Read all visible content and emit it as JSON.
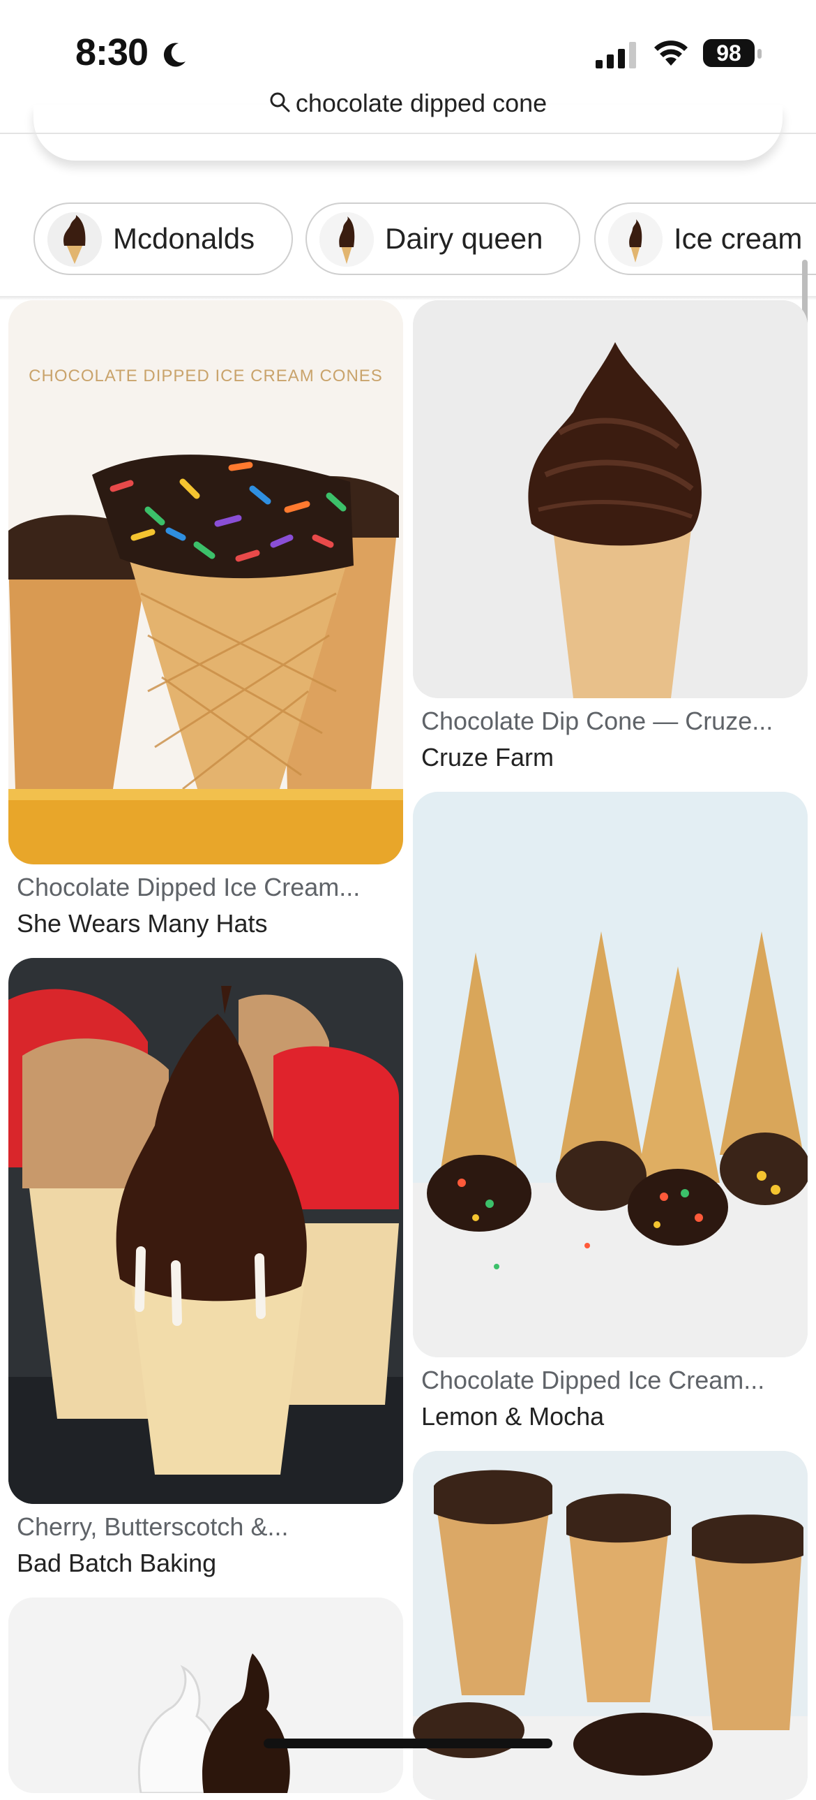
{
  "status_bar": {
    "time": "8:30",
    "battery": "98"
  },
  "search": {
    "query": "chocolate dipped cone"
  },
  "chips": [
    {
      "label": "Mcdonalds",
      "thumb_icon": "ice-cream-cone-icon"
    },
    {
      "label": "Dairy queen",
      "thumb_icon": "ice-cream-cone-icon"
    },
    {
      "label": "Ice cream",
      "thumb_icon": "ice-cream-cone-icon"
    }
  ],
  "pins": [
    {
      "image_text": "CHOCOLATE DIPPED ICE CREAM CONES",
      "title": "Chocolate Dipped Ice Cream...",
      "source": "She Wears Many Hats"
    },
    {
      "title": "Chocolate Dip Cone — Cruze...",
      "source": "Cruze Farm"
    },
    {
      "title": "Chocolate Dipped Ice Cream...",
      "source": "Lemon & Mocha"
    },
    {
      "title": "Cherry, Butterscotch &...",
      "source": "Bad Batch Baking"
    },
    {
      "title": "",
      "source": ""
    },
    {
      "title": "",
      "source": ""
    }
  ],
  "colors": {
    "title_gray": "#5f6368",
    "chip_border": "#cfcfcf",
    "chocolate": "#3a1d10",
    "cone": "#e2b56f"
  }
}
